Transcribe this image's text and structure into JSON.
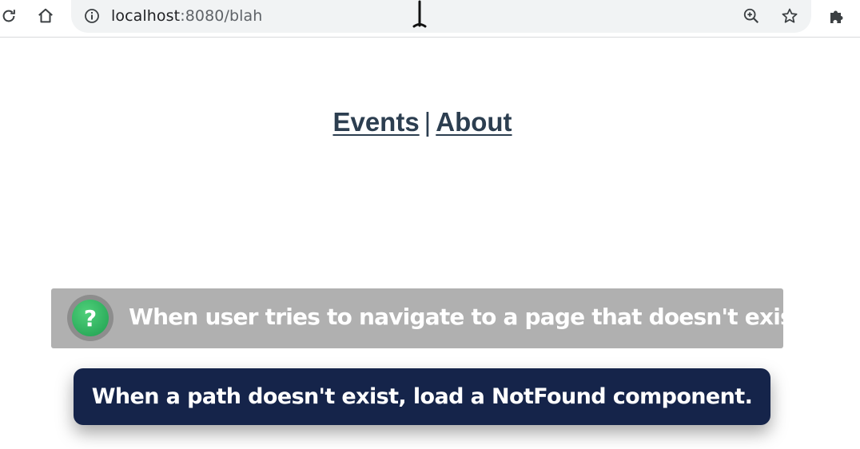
{
  "browser": {
    "url_host": "localhost",
    "url_rest": ":8080/blah",
    "icons": [
      "reload-icon",
      "home-icon",
      "info-icon",
      "zoom-icon",
      "bookmark-star-icon",
      "extensions-puzzle-icon"
    ]
  },
  "nav": {
    "links": [
      {
        "label": "Events"
      },
      {
        "label": "About"
      }
    ],
    "separator": "|"
  },
  "question": {
    "badge": "?",
    "text": "When user tries to navigate to a page that doesn't exist."
  },
  "answer": {
    "text": "When a path doesn't exist, load a NotFound component."
  },
  "colors": {
    "nav_text": "#2c3e50",
    "question_bg": "#b0b0b0",
    "badge_green": "#27ae60",
    "answer_bg": "#15244a"
  }
}
